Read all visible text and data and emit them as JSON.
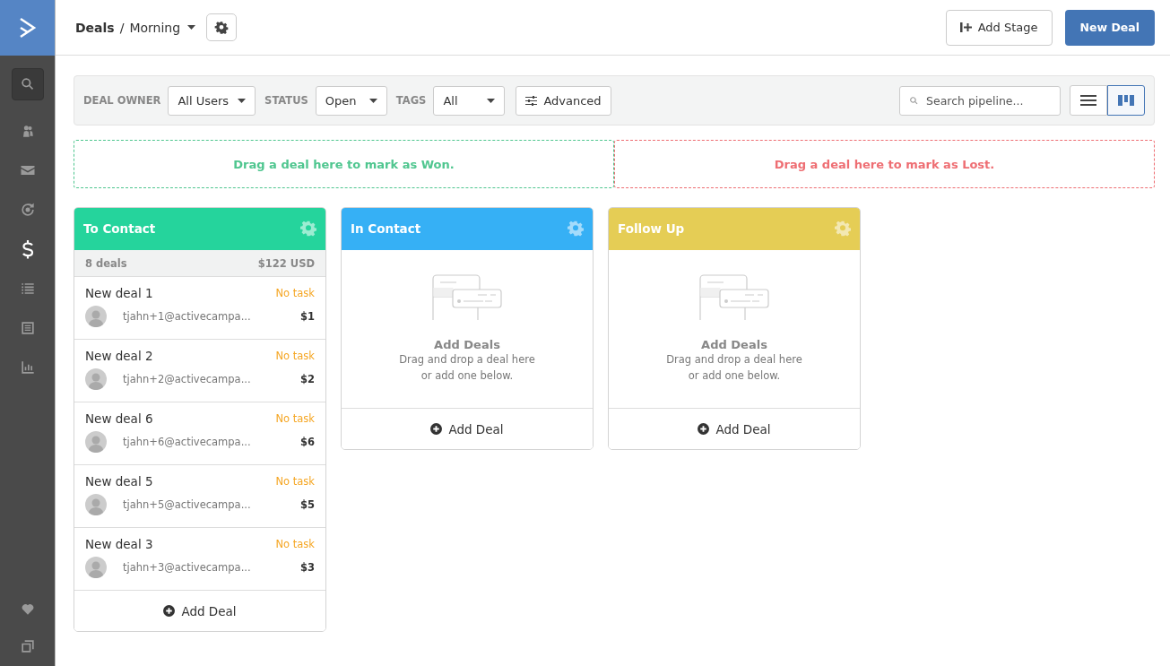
{
  "sidebar": {
    "items": [
      {
        "kind": "search",
        "selected": false
      },
      {
        "kind": "contacts",
        "selected": false
      },
      {
        "kind": "mail",
        "selected": false
      },
      {
        "kind": "automation",
        "selected": false
      },
      {
        "kind": "deals",
        "selected": true
      },
      {
        "kind": "lists",
        "selected": false
      },
      {
        "kind": "forms",
        "selected": false
      },
      {
        "kind": "reports",
        "selected": false
      }
    ],
    "bottom_items": [
      {
        "kind": "heart",
        "selected": false
      },
      {
        "kind": "windows",
        "selected": false
      }
    ]
  },
  "header": {
    "breadcrumb": "Deals",
    "separator": "/",
    "pipeline": "Morning",
    "add_stage": "Add Stage",
    "new_deal": "New Deal"
  },
  "filters": [
    {
      "label": "DEAL OWNER",
      "value": "All Users"
    },
    {
      "label": "STATUS",
      "value": "Open"
    },
    {
      "label": "TAGS",
      "value": "All"
    }
  ],
  "advanced": "Advanced",
  "search": {
    "placeholder": "Search pipeline..."
  },
  "view_toggle": [
    {
      "kind": "list",
      "selected": false
    },
    {
      "kind": "board",
      "selected": true
    }
  ],
  "drop_zones": [
    {
      "text": "Drag a deal here to mark as Won.",
      "color": "#4fc68f"
    },
    {
      "text": "Drag a deal here to mark as Lost.",
      "color": "#ee6e73"
    }
  ],
  "stages": [
    {
      "title": "To Contact",
      "color": "#25d49c",
      "count": "8 deals",
      "total": "$122 USD",
      "deals": [
        {
          "title": "New deal 1",
          "task": "No task",
          "contact": "tjahn+1@activecampa...",
          "value": "$1"
        },
        {
          "title": "New deal 2",
          "task": "No task",
          "contact": "tjahn+2@activecampa...",
          "value": "$2"
        },
        {
          "title": "New deal 6",
          "task": "No task",
          "contact": "tjahn+6@activecampa...",
          "value": "$6"
        },
        {
          "title": "New deal 5",
          "task": "No task",
          "contact": "tjahn+5@activecampa...",
          "value": "$5"
        },
        {
          "title": "New deal 3",
          "task": "No task",
          "contact": "tjahn+3@activecampa...",
          "value": "$3"
        }
      ],
      "add": "Add Deal"
    },
    {
      "title": "In Contact",
      "color": "#36b0f5",
      "empty_title": "Add Deals",
      "empty_text": "Drag and drop a deal here or add one below.",
      "add": "Add Deal"
    },
    {
      "title": "Follow Up",
      "color": "#e5cd55",
      "empty_title": "Add Deals",
      "empty_text": "Drag and drop a deal here or add one below.",
      "add": "Add Deal"
    }
  ]
}
